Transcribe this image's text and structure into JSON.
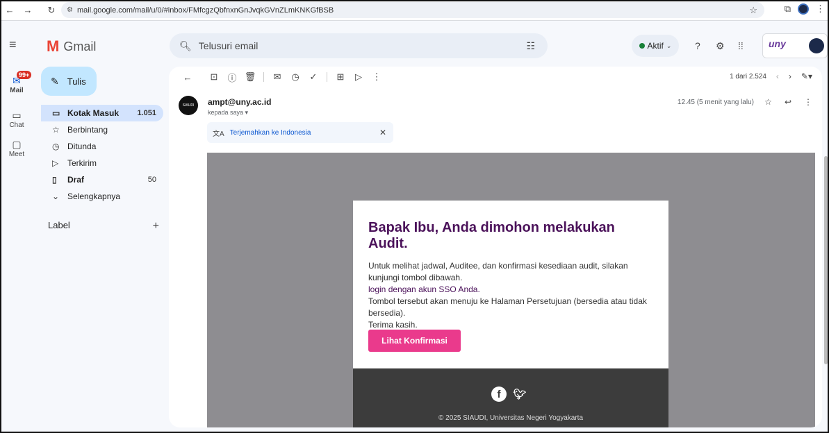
{
  "browser": {
    "url": "mail.google.com/mail/u/0/#inbox/FMfcgzQbfnxnGnJvqkGVnZLmKNKGfBSB",
    "back_icon": "arrow-left",
    "forward_icon": "arrow-right",
    "reload_icon": "reload"
  },
  "app": {
    "logo_letter": "M",
    "name": "Gmail"
  },
  "rail": {
    "mail_label": "Mail",
    "mail_badge": "99+",
    "chat_label": "Chat",
    "meet_label": "Meet"
  },
  "search": {
    "placeholder": "Telusuri email"
  },
  "status": {
    "label": "Aktif",
    "color": "#188038"
  },
  "brand": {
    "logo_text": "uny"
  },
  "compose": {
    "label": "Tulis"
  },
  "nav": [
    {
      "label": "Kotak Masuk",
      "count": "1.051",
      "icon": "inbox-icon"
    },
    {
      "label": "Berbintang",
      "count": "",
      "icon": "star-icon"
    },
    {
      "label": "Ditunda",
      "count": "",
      "icon": "clock-icon"
    },
    {
      "label": "Terkirim",
      "count": "",
      "icon": "send-icon"
    },
    {
      "label": "Draf",
      "count": "50",
      "icon": "draft-icon"
    },
    {
      "label": "Selengkapnya",
      "count": "",
      "icon": "chevron-down-icon"
    }
  ],
  "labels": {
    "title": "Label"
  },
  "toolbar": {
    "pagination": "1 dari 2.524"
  },
  "message": {
    "sender": "ampt@uny.ac.id",
    "recipient": "kepada saya ▾",
    "time": "12.45 (5 menit yang lalu)",
    "avatar_text": "SIAUDI",
    "translate_label": "Terjemahkan ke Indonesia"
  },
  "email": {
    "title": "Bapak Ibu, Anda dimohon melakukan Audit.",
    "p1": "Untuk melihat jadwal, Auditee, dan konfirmasi kesediaan audit, silakan kunjungi tombol dibawah.",
    "link": "login dengan akun SSO Anda.",
    "p2": "Tombol tersebut akan menuju ke Halaman Persetujuan (bersedia atau tidak bersedia).",
    "p3": "Terima kasih.",
    "button": "Lihat Konfirmasi",
    "copyright": "© 2025 SIAUDI, Universitas Negeri Yogyakarta",
    "accent_color": "#ea3a8c",
    "title_color": "#4b125a"
  }
}
